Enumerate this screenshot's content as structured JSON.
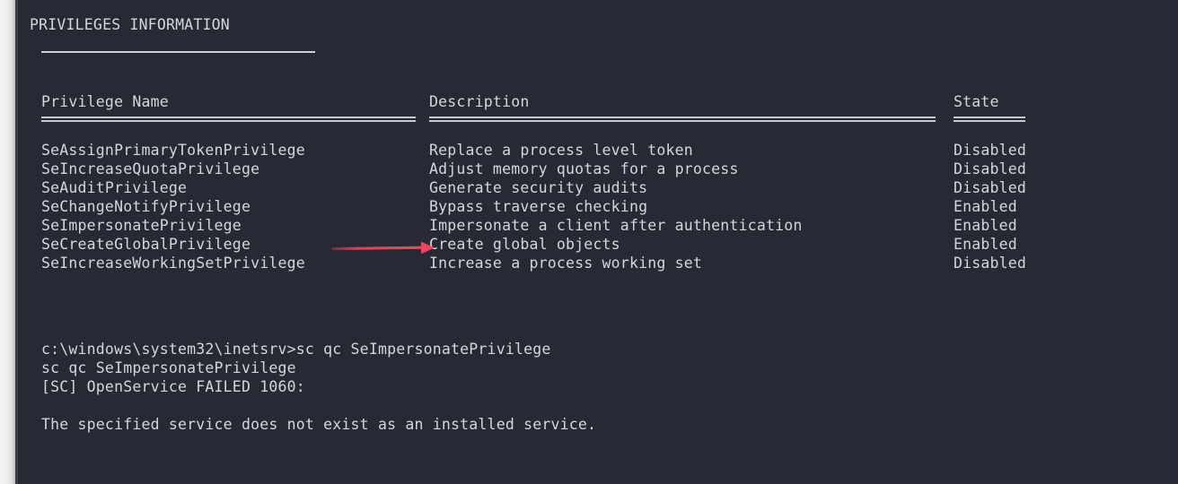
{
  "terminal": {
    "section_title": "PRIVILEGES INFORMATION",
    "columns": {
      "privilege_name": "Privilege Name",
      "description": "Description",
      "state": "State"
    },
    "rows": [
      {
        "privilege": "SeAssignPrimaryTokenPrivilege",
        "description": "Replace a process level token",
        "state": "Disabled"
      },
      {
        "privilege": "SeIncreaseQuotaPrivilege",
        "description": "Adjust memory quotas for a process",
        "state": "Disabled"
      },
      {
        "privilege": "SeAuditPrivilege",
        "description": "Generate security audits",
        "state": "Disabled"
      },
      {
        "privilege": "SeChangeNotifyPrivilege",
        "description": "Bypass traverse checking",
        "state": "Enabled"
      },
      {
        "privilege": "SeImpersonatePrivilege",
        "description": "Impersonate a client after authentication",
        "state": "Enabled"
      },
      {
        "privilege": "SeCreateGlobalPrivilege",
        "description": "Create global objects",
        "state": "Enabled"
      },
      {
        "privilege": "SeIncreaseWorkingSetPrivilege",
        "description": "Increase a process working set",
        "state": "Disabled"
      }
    ],
    "console": {
      "prompt_line": "c:\\windows\\system32\\inetsrv>sc qc SeImpersonatePrivilege",
      "echo_line": "sc qc SeImpersonatePrivilege",
      "error_line": "[SC] OpenService FAILED 1060:",
      "detail_line": "The specified service does not exist as an installed service."
    }
  },
  "annotation": {
    "arrow_color": "#f2445c",
    "points_to": "Impersonate a client after authentication"
  },
  "colors": {
    "background": "#252a34",
    "text": "#d3d6dd",
    "rule": "#c6c9d0",
    "gutter": "#eeeeee"
  }
}
